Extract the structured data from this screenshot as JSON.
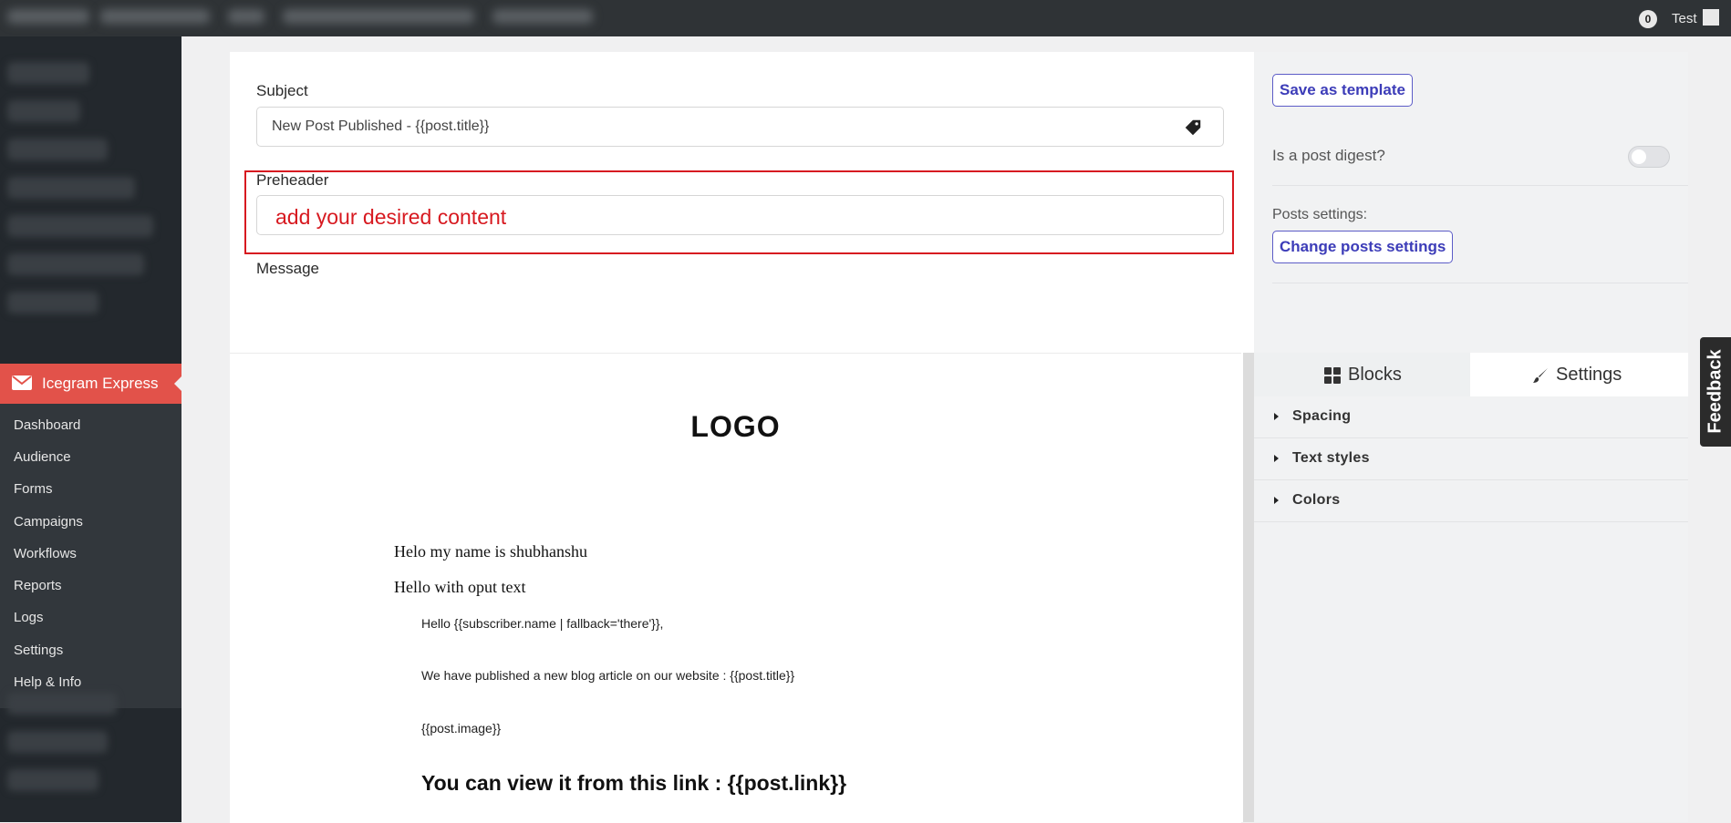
{
  "admin_bar": {
    "notifications_count": "0",
    "user_name": "Test"
  },
  "sidebar": {
    "active_menu_label": "Icegram Express",
    "submenu": [
      "Dashboard",
      "Audience",
      "Forms",
      "Campaigns",
      "Workflows",
      "Reports",
      "Logs",
      "Settings",
      "Help & Info"
    ]
  },
  "editor": {
    "subject_label": "Subject",
    "subject_value": "New Post Published - {{post.title}}",
    "preheader_label": "Preheader",
    "preheader_value": "add your desired content",
    "message_label": "Message",
    "toolbar_icons": [
      "desktop-icon",
      "tablet-icon",
      "mobile-icon",
      "eraser-icon",
      "undo-icon",
      "redo-icon"
    ]
  },
  "canvas": {
    "logo": "LOGO",
    "line_1": "Helo my name is shubhanshu",
    "line_2": "Hello with oput text",
    "greeting": "Hello {{subscriber.name | fallback='there'}},",
    "announcement": "We have published a new blog article on our website : {{post.title}}",
    "image_tag": "{{post.image}}",
    "view_link": "You can view it from this link : {{post.link}}"
  },
  "right_panel": {
    "save_template_label": "Save as template",
    "post_digest_label": "Is a post digest?",
    "post_digest_enabled": false,
    "posts_settings_label": "Posts settings:",
    "change_posts_label": "Change posts settings",
    "tabs": {
      "blocks": "Blocks",
      "settings": "Settings"
    },
    "sections": [
      "Spacing",
      "Text styles",
      "Colors"
    ]
  },
  "feedback_label": "Feedback",
  "colors": {
    "accent_red": "#e2524a",
    "highlight_red": "#d71920",
    "link_blue": "#3c3cb8"
  }
}
